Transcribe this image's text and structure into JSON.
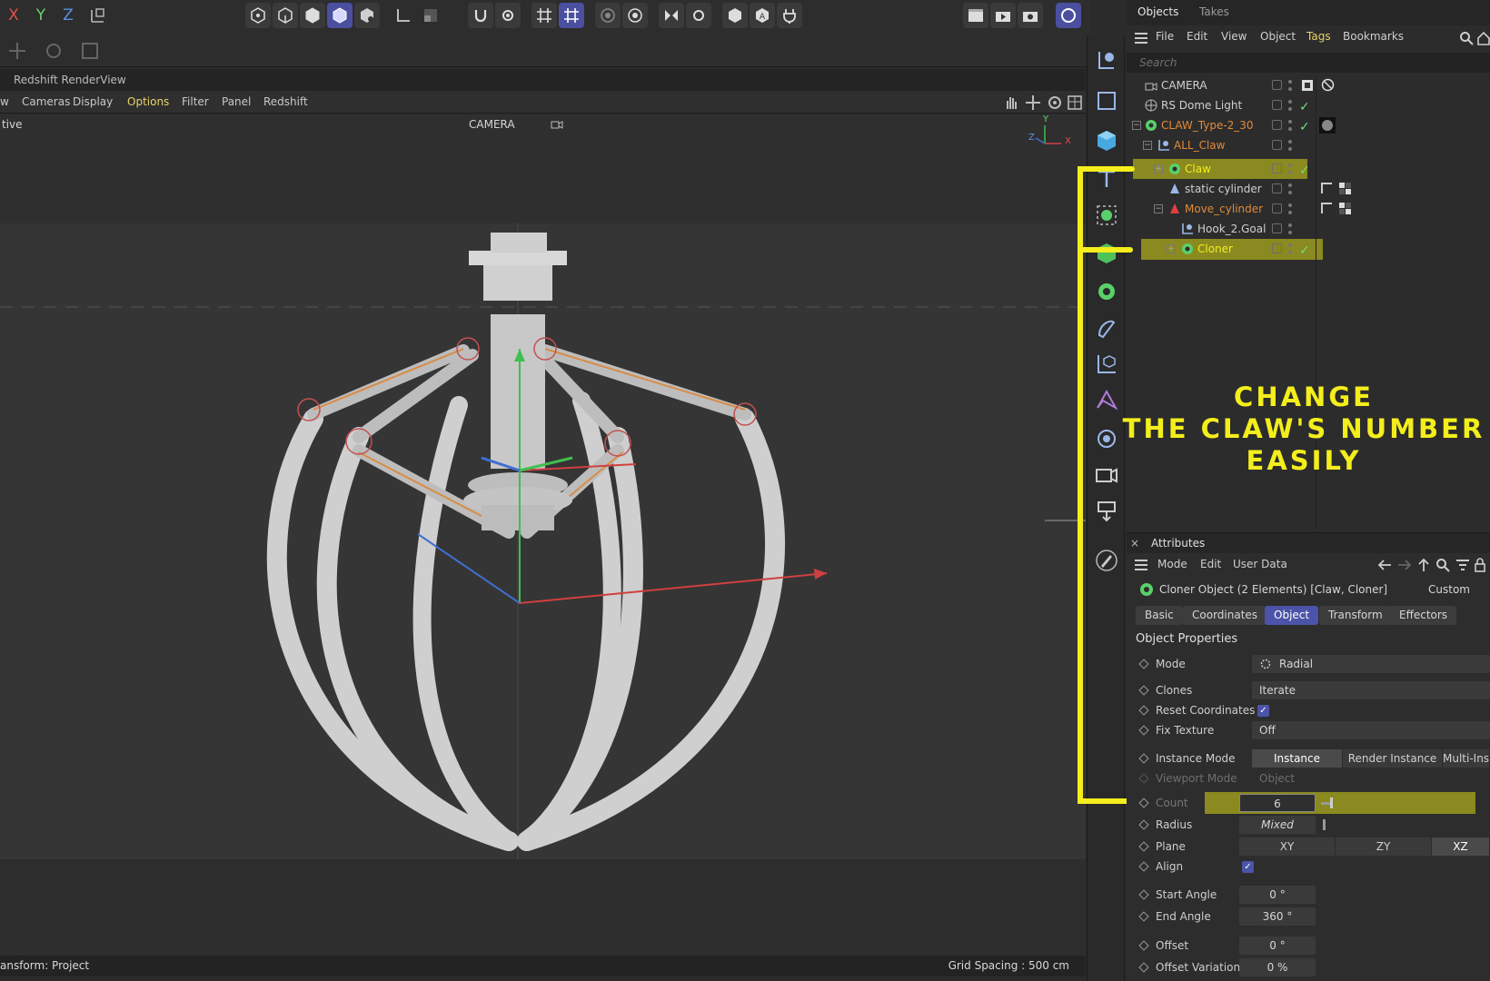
{
  "toolbar": {
    "axis_labels": [
      "X",
      "Y",
      "Z"
    ],
    "axis_colors": [
      "#e05050",
      "#6cd06c",
      "#5a8fe0"
    ]
  },
  "renderview": {
    "title": "Redshift RenderView"
  },
  "viewport": {
    "menus": [
      "w",
      "Cameras",
      "Display",
      "Options",
      "Filter",
      "Panel",
      "Redshift"
    ],
    "highlighted_menu": "Options",
    "projection_label": "tive",
    "camera_label": "CAMERA",
    "status_left": "ansform: Project",
    "grid_spacing": "Grid Spacing : 500 cm",
    "axis_gizmo": {
      "y": "Y",
      "z": "Z",
      "x": "X"
    }
  },
  "objects_panel": {
    "tabs": [
      "Objects",
      "Takes"
    ],
    "menu": [
      "File",
      "Edit",
      "View",
      "Object",
      "Tags",
      "Bookmarks"
    ],
    "highlighted_menu": "Tags",
    "search_placeholder": "Search",
    "rows": [
      {
        "name": "CAMERA",
        "color": "#d0d0d0",
        "icon": "camera-icon",
        "check": false
      },
      {
        "name": "RS Dome Light",
        "color": "#d0d0d0",
        "icon": "globe-icon",
        "check": true
      },
      {
        "name": "CLAW_Type-2_30",
        "color": "#e08a3a",
        "icon": "cloner-gear-icon",
        "check": true
      },
      {
        "name": "ALL_Claw",
        "color": "#e08a3a",
        "icon": "null-icon",
        "check": false
      },
      {
        "name": "Claw",
        "color": "#f3ee1c",
        "icon": "cloner-gear-icon",
        "check": true
      },
      {
        "name": "static cylinder",
        "color": "#d0d0d0",
        "icon": "bone-icon",
        "check": false
      },
      {
        "name": "Move_cylinder",
        "color": "#e08a3a",
        "icon": "bone-red-icon",
        "check": false
      },
      {
        "name": "Hook_2.Goal",
        "color": "#d0d0d0",
        "icon": "null-icon",
        "check": false
      },
      {
        "name": "Cloner",
        "color": "#f3ee1c",
        "icon": "cloner-gear-icon",
        "check": true
      }
    ]
  },
  "annotation": {
    "lines": [
      "CHANGE",
      "THE CLAW'S NUMBER",
      "EASILY"
    ],
    "color": "#f3ee1c"
  },
  "attributes": {
    "title": "Attributes",
    "menu": [
      "Mode",
      "Edit",
      "User Data"
    ],
    "object_name": "Cloner Object (2 Elements) [Claw, Cloner]",
    "preset": "Custom",
    "tabs": [
      "Basic",
      "Coordinates",
      "Object",
      "Transform",
      "Effectors"
    ],
    "active_tab": "Object",
    "section": "Object Properties",
    "mode": {
      "label": "Mode",
      "value": "Radial"
    },
    "clones": {
      "label": "Clones",
      "value": "Iterate"
    },
    "reset_coordinates": {
      "label": "Reset Coordinates",
      "checked": true
    },
    "fix_texture": {
      "label": "Fix Texture",
      "value": "Off"
    },
    "instance_mode": {
      "label": "Instance Mode",
      "options": [
        "Instance",
        "Render Instance",
        "Multi-Ins"
      ],
      "selected": "Instance"
    },
    "viewport_mode": {
      "label": "Viewport Mode",
      "value": "Object"
    },
    "count": {
      "label": "Count",
      "value": "6"
    },
    "radius": {
      "label": "Radius",
      "value": "Mixed"
    },
    "plane": {
      "label": "Plane",
      "options": [
        "XY",
        "ZY",
        "XZ"
      ],
      "selected": "XZ"
    },
    "align": {
      "label": "Align",
      "checked": true
    },
    "start_angle": {
      "label": "Start Angle",
      "value": "0 °"
    },
    "end_angle": {
      "label": "End Angle",
      "value": "360 °"
    },
    "offset": {
      "label": "Offset",
      "value": "0 °"
    },
    "offset_variation": {
      "label": "Offset Variation",
      "value": "0 %"
    }
  },
  "colors": {
    "accent": "#4b54a8",
    "highlight_yellow": "#f3ee1c",
    "orange_name": "#e08a3a",
    "check_green": "#6fe07a"
  }
}
